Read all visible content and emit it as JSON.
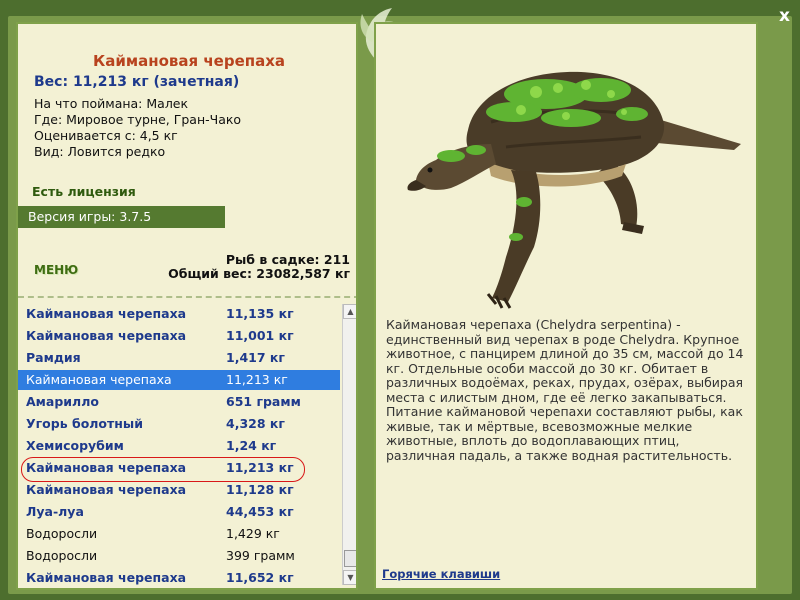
{
  "window": {
    "close_label": "x"
  },
  "fish": {
    "title": "Каймановая черепаха",
    "weight": "Вес: 11,213 кг (зачетная)",
    "caught_on": "На что поймана: Малек",
    "location": "Где: Мировое турне, Гран-Чако",
    "value": "Оценивается с: 4,5 кг",
    "rarity": "Вид: Ловится редко"
  },
  "license": "Есть лицензия",
  "version": "Версия игры: 3.7.5",
  "menu": {
    "label": "МЕНЮ"
  },
  "keepnet": {
    "count": "Рыб в садке: 211",
    "total": "Общий вес: 23082,587 кг"
  },
  "catch_list": [
    {
      "name": "Каймановая черепаха",
      "weight": "11,135 кг",
      "style": "bold"
    },
    {
      "name": "Каймановая черепаха",
      "weight": "11,001 кг",
      "style": "bold"
    },
    {
      "name": "Рамдия",
      "weight": "1,417 кг",
      "style": "bold"
    },
    {
      "name": "Каймановая черепаха",
      "weight": "11,213 кг",
      "style": "selected"
    },
    {
      "name": "Амарилло",
      "weight": "651 грамм",
      "style": "bold"
    },
    {
      "name": "Угорь болотный",
      "weight": "4,328 кг",
      "style": "bold"
    },
    {
      "name": "Хемисорубим",
      "weight": "1,24 кг",
      "style": "bold"
    },
    {
      "name": "Каймановая черепаха",
      "weight": "11,213 кг",
      "style": "bold"
    },
    {
      "name": "Каймановая черепаха",
      "weight": "11,128 кг",
      "style": "bold"
    },
    {
      "name": "Луа-луа",
      "weight": "44,453 кг",
      "style": "bold"
    },
    {
      "name": "Водоросли",
      "weight": "1,429 кг",
      "style": "plain"
    },
    {
      "name": "Водоросли",
      "weight": "399 грамм",
      "style": "plain"
    },
    {
      "name": "Каймановая черепаха",
      "weight": "11,652 кг",
      "style": "bold"
    }
  ],
  "description": "Каймановая черепаха (Chelydra serpentina) - единственный вид черепах в роде Chelydra. Крупное животное, с панцирем длиной до 35 см, массой до 14 кг. Отдельные особи массой до 30 кг. Обитает в различных водоёмах, реках, прудах, озёрах, выбирая места с илистым дном, где её легко закапываться. Питание каймановой черепахи составляют рыбы, как живые, так и мёртвые, всевозможные мелкие животные, вплоть до водоплавающих птиц, различная падаль, а также водная растительность.",
  "hotkeys": "Горячие клавиши",
  "colors": {
    "frame": "#4d6e2e",
    "panel": "#f3f1d4",
    "title": "#b8431e",
    "link": "#1e3a8c",
    "selection": "#2f7de0",
    "highlight_circle": "#d81818"
  }
}
